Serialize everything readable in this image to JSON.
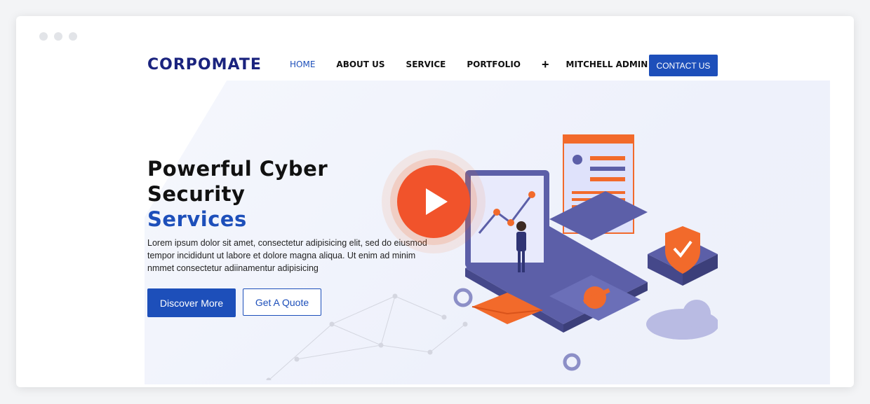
{
  "brand": {
    "logo_text": "CORPOMATE"
  },
  "nav": {
    "items": [
      {
        "label": "HOME",
        "active": true
      },
      {
        "label": "ABOUT US",
        "active": false
      },
      {
        "label": "SERVICE",
        "active": false
      },
      {
        "label": "PORTFOLIO",
        "active": false
      },
      {
        "label": "+",
        "active": false
      },
      {
        "label": "MITCHELL ADMIN",
        "active": false
      }
    ],
    "contact_label": "CONTACT US"
  },
  "hero": {
    "title_line1": "Powerful Cyber",
    "title_line2": "Security",
    "title_accent": "Services",
    "description": "Lorem ipsum dolor sit amet, consectetur adipisicing elit, sed do eiusmod tempor incididunt ut labore et dolore magna aliqua. Ut enim ad minim nmmet consectetur adiinamentur adipisicing",
    "primary_button": "Discover More",
    "secondary_button": "Get A Quote"
  },
  "colors": {
    "brand_blue": "#1d4fba",
    "logo_navy": "#1a237e",
    "accent_orange": "#f26a2b",
    "illustration_purple": "#5c5fa8"
  },
  "icons": {
    "play": "play-icon",
    "shield": "shield-check-icon",
    "key": "key-icon",
    "envelope": "envelope-icon",
    "gear": "gear-icon"
  }
}
